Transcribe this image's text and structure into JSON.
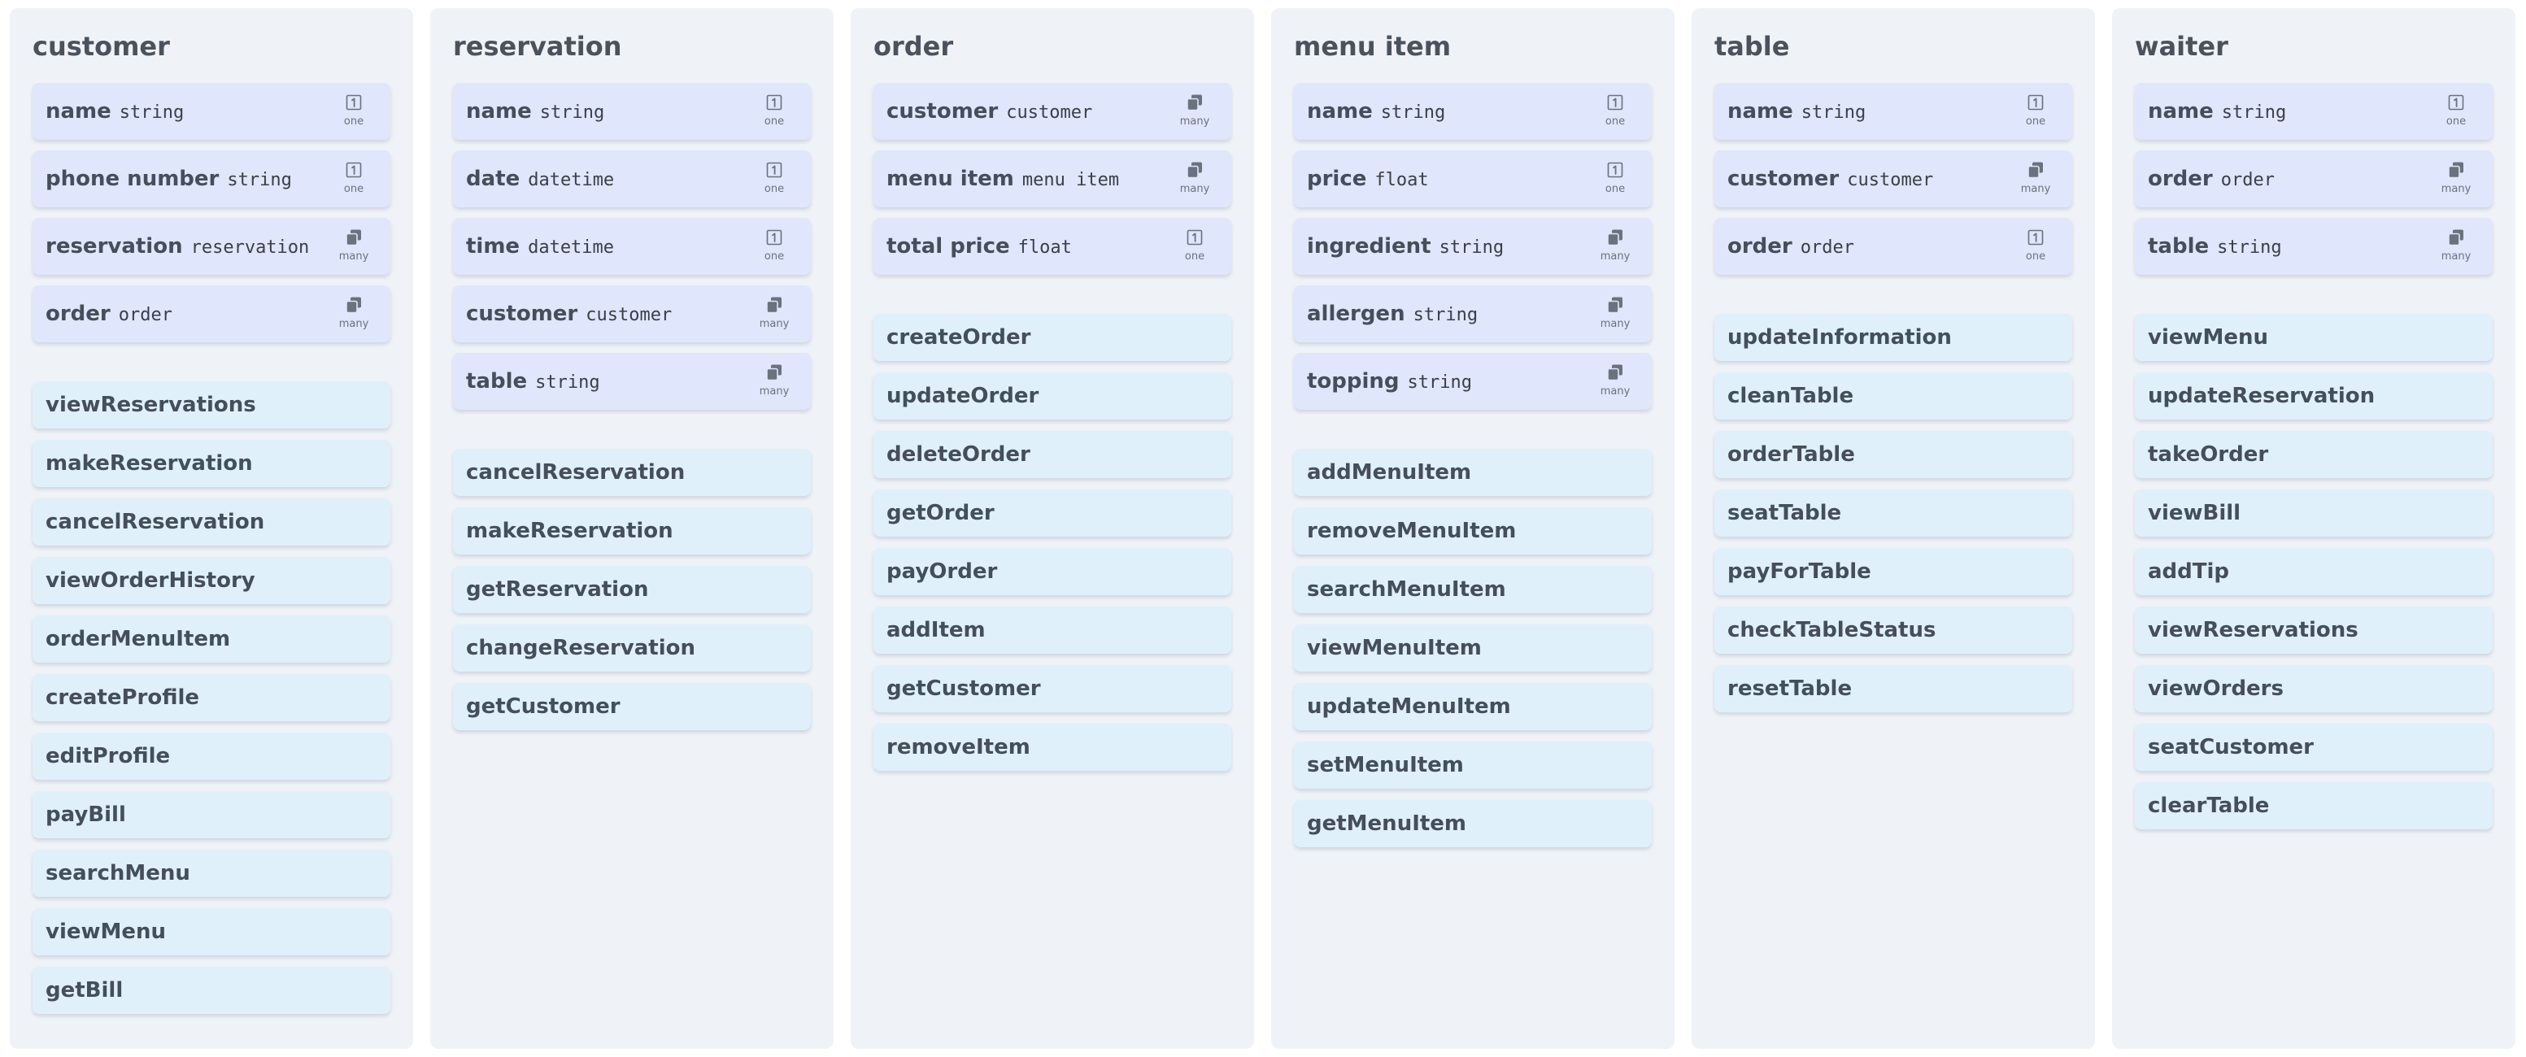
{
  "classes": [
    {
      "name": "customer",
      "attributes": [
        {
          "name": "name",
          "type": "string",
          "cardinality": "one",
          "icon": "one-icon"
        },
        {
          "name": "phone number",
          "type": "string",
          "cardinality": "one",
          "icon": "one-icon"
        },
        {
          "name": "reservation",
          "type": "reservation",
          "cardinality": "many",
          "icon": "many-icon"
        },
        {
          "name": "order",
          "type": "order",
          "cardinality": "many",
          "icon": "many-icon"
        }
      ],
      "methods": [
        "viewReservations",
        "makeReservation",
        "cancelReservation",
        "viewOrderHistory",
        "orderMenuItem",
        "createProfile",
        "editProfile",
        "payBill",
        "searchMenu",
        "viewMenu",
        "getBill"
      ]
    },
    {
      "name": "reservation",
      "attributes": [
        {
          "name": "name",
          "type": "string",
          "cardinality": "one",
          "icon": "one-icon"
        },
        {
          "name": "date",
          "type": "datetime",
          "cardinality": "one",
          "icon": "one-icon"
        },
        {
          "name": "time",
          "type": "datetime",
          "cardinality": "one",
          "icon": "one-icon"
        },
        {
          "name": "customer",
          "type": "customer",
          "cardinality": "many",
          "icon": "many-icon"
        },
        {
          "name": "table",
          "type": "string",
          "cardinality": "many",
          "icon": "many-icon"
        }
      ],
      "methods": [
        "cancelReservation",
        "makeReservation",
        "getReservation",
        "changeReservation",
        "getCustomer"
      ]
    },
    {
      "name": "order",
      "attributes": [
        {
          "name": "customer",
          "type": "customer",
          "cardinality": "many",
          "icon": "many-icon"
        },
        {
          "name": "menu item",
          "type": "menu item",
          "cardinality": "many",
          "icon": "many-icon"
        },
        {
          "name": "total price",
          "type": "float",
          "cardinality": "one",
          "icon": "one-icon"
        }
      ],
      "methods": [
        "createOrder",
        "updateOrder",
        "deleteOrder",
        "getOrder",
        "payOrder",
        "addItem",
        "getCustomer",
        "removeItem"
      ]
    },
    {
      "name": "menu item",
      "attributes": [
        {
          "name": "name",
          "type": "string",
          "cardinality": "one",
          "icon": "one-icon"
        },
        {
          "name": "price",
          "type": "float",
          "cardinality": "one",
          "icon": "one-icon"
        },
        {
          "name": "ingredient",
          "type": "string",
          "cardinality": "many",
          "icon": "many-icon"
        },
        {
          "name": "allergen",
          "type": "string",
          "cardinality": "many",
          "icon": "many-icon"
        },
        {
          "name": "topping",
          "type": "string",
          "cardinality": "many",
          "icon": "many-icon"
        }
      ],
      "methods": [
        "addMenuItem",
        "removeMenuItem",
        "searchMenuItem",
        "viewMenuItem",
        "updateMenuItem",
        "setMenuItem",
        "getMenuItem"
      ]
    },
    {
      "name": "table",
      "attributes": [
        {
          "name": "name",
          "type": "string",
          "cardinality": "one",
          "icon": "one-icon"
        },
        {
          "name": "customer",
          "type": "customer",
          "cardinality": "many",
          "icon": "many-icon"
        },
        {
          "name": "order",
          "type": "order",
          "cardinality": "one",
          "icon": "one-icon"
        }
      ],
      "methods": [
        "updateInformation",
        "cleanTable",
        "orderTable",
        "seatTable",
        "payForTable",
        "checkTableStatus",
        "resetTable"
      ]
    },
    {
      "name": "waiter",
      "attributes": [
        {
          "name": "name",
          "type": "string",
          "cardinality": "one",
          "icon": "one-icon"
        },
        {
          "name": "order",
          "type": "order",
          "cardinality": "many",
          "icon": "many-icon"
        },
        {
          "name": "table",
          "type": "string",
          "cardinality": "many",
          "icon": "many-icon"
        }
      ],
      "methods": [
        "viewMenu",
        "updateReservation",
        "takeOrder",
        "viewBill",
        "addTip",
        "viewReservations",
        "viewOrders",
        "seatCustomer",
        "clearTable"
      ]
    }
  ]
}
